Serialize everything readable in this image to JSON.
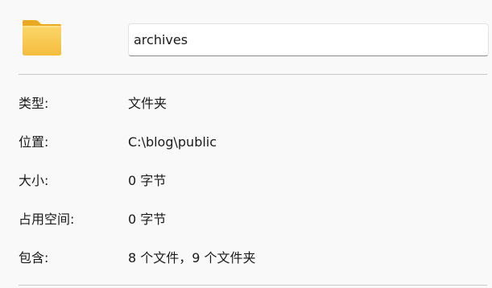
{
  "folder": {
    "icon": "folder-icon",
    "name": "archives"
  },
  "properties": [
    {
      "label": "类型:",
      "value": "文件夹"
    },
    {
      "label": "位置:",
      "value": "C:\\blog\\public"
    },
    {
      "label": "大小:",
      "value": "0 字节"
    },
    {
      "label": "占用空间:",
      "value": "0 字节"
    },
    {
      "label": "包含:",
      "value": "8 个文件，9 个文件夹"
    }
  ],
  "colors": {
    "background": "#f9f9f9",
    "folder_body": "#f8c948",
    "folder_tab": "#e9a920",
    "divider": "#c8c8c8"
  }
}
